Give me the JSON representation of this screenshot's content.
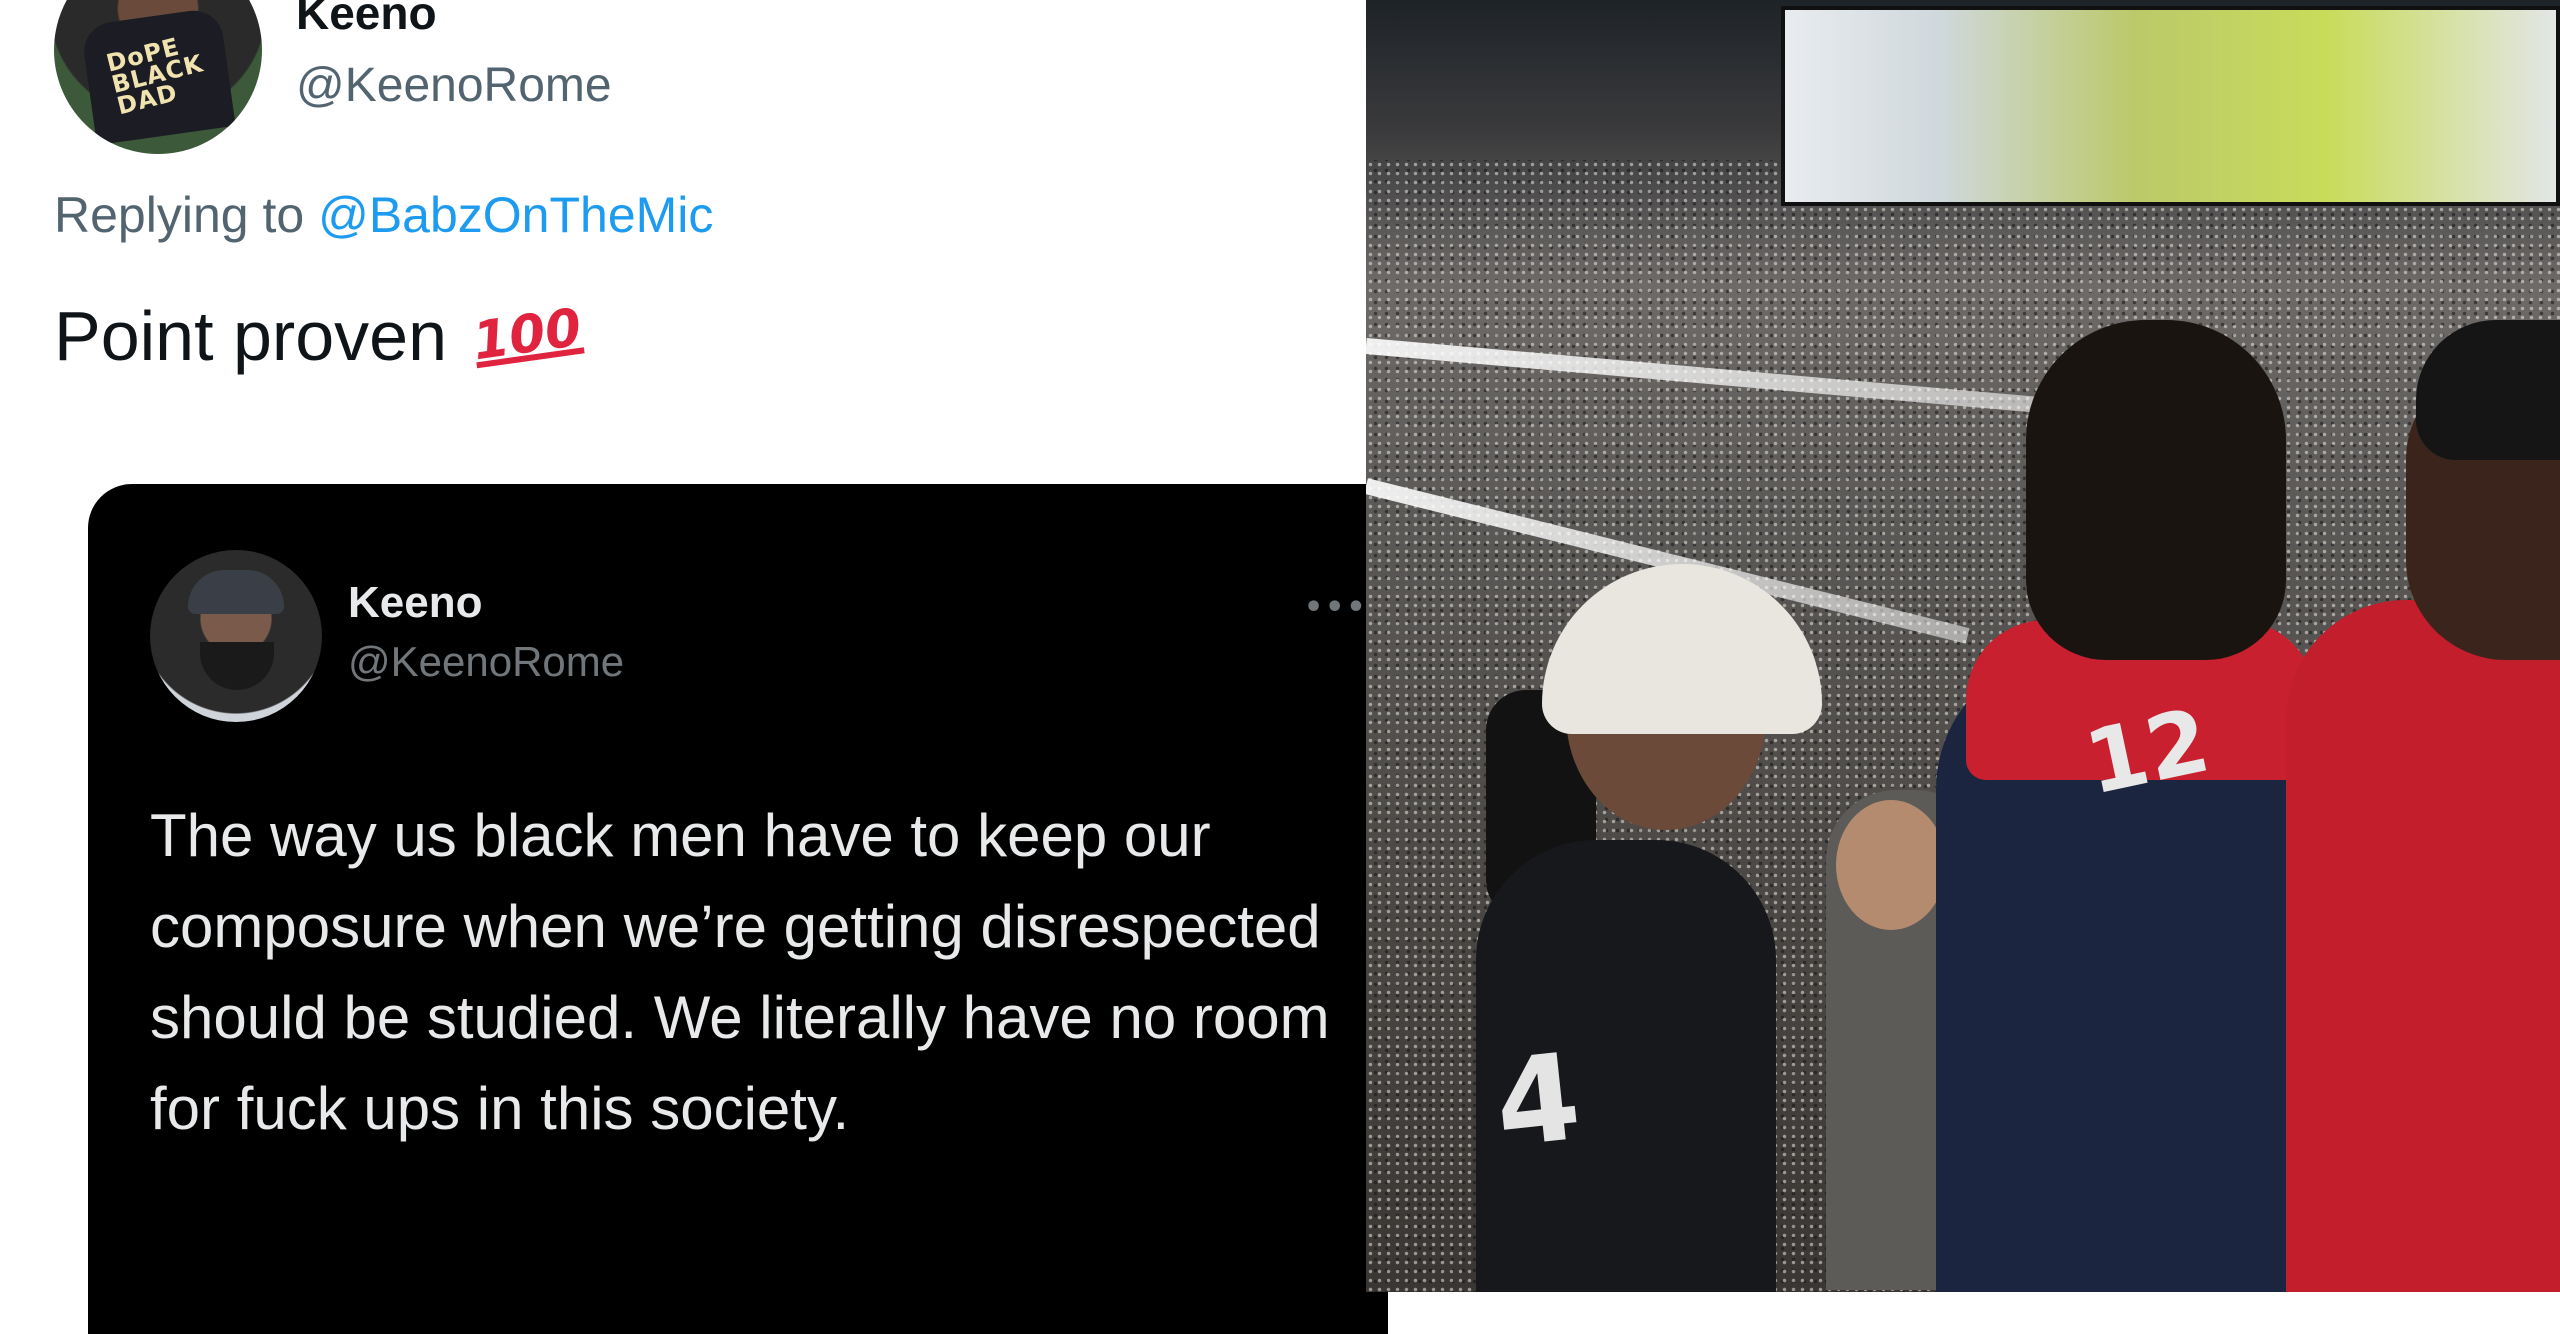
{
  "tweet": {
    "author_name": "Keeno",
    "author_handle": "@KeenoRome",
    "replying_prefix": "Replying to",
    "replying_to": "@BabzOnTheMic",
    "text": "Point proven",
    "emoji": "100",
    "avatar_shirt_text": "DoPE BLACK DAD"
  },
  "quoted_tweet": {
    "author_name": "Keeno",
    "author_handle": "@KeenoRome",
    "more_glyph": "•••",
    "text": "The way us black men have to keep our composure when we’re getting disrespected should be studied. We literally have no room for fuck ups in this society."
  },
  "photo": {
    "jersey_left_number": "4",
    "jersey_right_number": "12"
  },
  "colors": {
    "link": "#1d9bf0",
    "secondary_text": "#536471",
    "dark_card": "#000000",
    "hundred_emoji": "#e0243f"
  }
}
